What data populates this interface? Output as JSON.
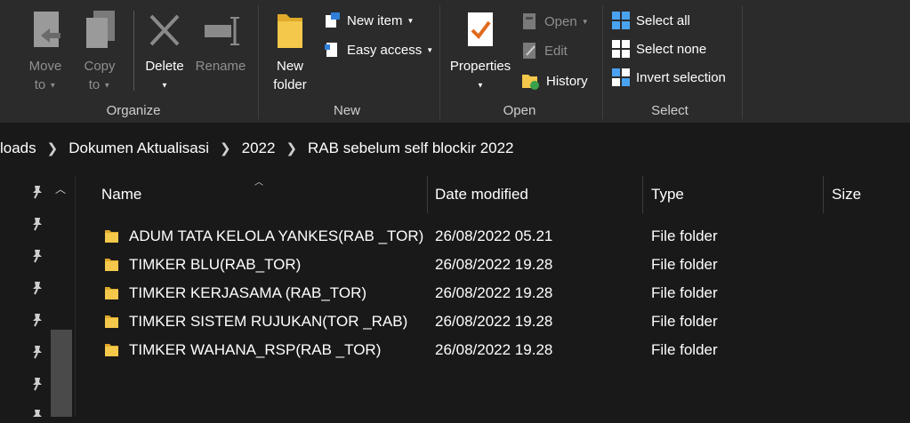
{
  "ribbon": {
    "organize": {
      "label": "Organize",
      "move_to": [
        "Move",
        "to"
      ],
      "copy_to": [
        "Copy",
        "to"
      ],
      "delete": "Delete",
      "rename": "Rename"
    },
    "new": {
      "label": "New",
      "new_folder": [
        "New",
        "folder"
      ],
      "new_item": "New item",
      "easy_access": "Easy access"
    },
    "open": {
      "label": "Open",
      "properties": "Properties",
      "open": "Open",
      "edit": "Edit",
      "history": "History"
    },
    "select": {
      "label": "Select",
      "select_all": "Select all",
      "select_none": "Select none",
      "invert_selection": "Invert selection"
    }
  },
  "breadcrumb": [
    "loads",
    "Dokumen Aktualisasi",
    "2022",
    "RAB sebelum self blockir 2022"
  ],
  "columns": {
    "name": "Name",
    "date": "Date modified",
    "type": "Type",
    "size": "Size"
  },
  "files": [
    {
      "name": "ADUM TATA KELOLA YANKES(RAB _TOR)",
      "date": "26/08/2022 05.21",
      "type": "File folder"
    },
    {
      "name": "TIMKER BLU(RAB_TOR)",
      "date": "26/08/2022 19.28",
      "type": "File folder"
    },
    {
      "name": "TIMKER KERJASAMA (RAB_TOR)",
      "date": "26/08/2022 19.28",
      "type": "File folder"
    },
    {
      "name": "TIMKER SISTEM RUJUKAN(TOR _RAB)",
      "date": "26/08/2022 19.28",
      "type": "File folder"
    },
    {
      "name": "TIMKER WAHANA_RSP(RAB _TOR)",
      "date": "26/08/2022 19.28",
      "type": "File folder"
    }
  ],
  "colors": {
    "background": "#191919",
    "ribbon": "#2b2b2b",
    "folder": "#f3c84b",
    "accent": "#0a84ff"
  },
  "icons": {
    "move_to": "move-to-icon",
    "copy_to": "copy-to-icon",
    "delete": "delete-x-icon",
    "rename": "rename-icon",
    "new_folder": "folder-icon",
    "new_item": "new-item-icon",
    "easy_access": "easy-access-icon",
    "properties": "properties-check-icon",
    "open": "open-icon",
    "edit": "edit-icon",
    "history": "history-icon",
    "select_all": "select-all-icon",
    "select_none": "select-none-icon",
    "invert_selection": "invert-selection-icon",
    "pin": "pin-icon",
    "row": "folder-icon"
  }
}
